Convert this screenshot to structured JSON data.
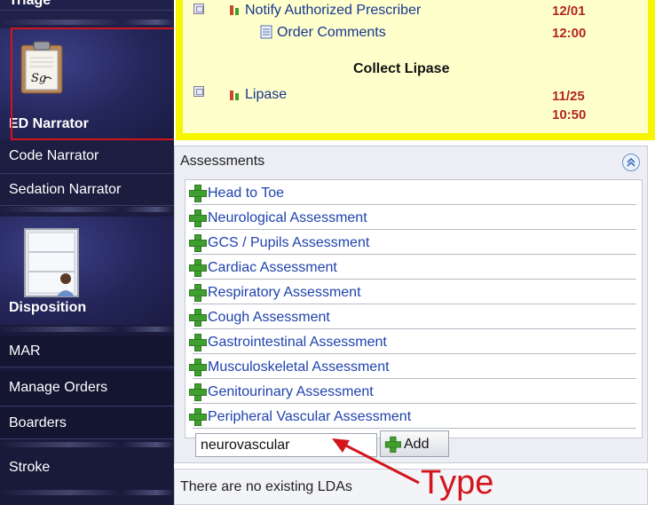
{
  "sidebar": {
    "top_cut_label": "Triage",
    "ed_narrator": "ED Narrator",
    "code_narrator": "Code Narrator",
    "sedation_narrator": "Sedation Narrator",
    "disposition": "Disposition",
    "mar": "MAR",
    "manage_orders": "Manage Orders",
    "boarders": "Boarders",
    "stroke": "Stroke"
  },
  "orders": {
    "row1_label": "Notify Authorized Prescriber",
    "row1_time": "12/01",
    "row2_label": "Order Comments",
    "row2_time": "12:00",
    "section_heading": "Collect Lipase",
    "row3_label": "Lipase",
    "row3_time_date": "11/25",
    "row3_time_clock": "10:50"
  },
  "assessments": {
    "title": "Assessments",
    "items": [
      "Head to Toe",
      "Neurological Assessment",
      "GCS / Pupils Assessment",
      "Cardiac Assessment",
      "Respiratory Assessment",
      "Cough Assessment",
      "Gastrointestinal Assessment",
      "Musculoskeletal Assessment",
      "Genitourinary Assessment",
      "Peripheral Vascular Assessment"
    ],
    "input_value": "neurovascular",
    "add_label": "Add"
  },
  "lda": {
    "message": "There are no existing LDAs"
  },
  "annotation": {
    "text": "Type",
    "color": "#d4141c"
  },
  "icons": [
    "clipboard-signature-icon",
    "window-person-icon",
    "plus-icon",
    "collapse-chevrons-icon",
    "flask-icon",
    "document-icon",
    "order-square-icon"
  ]
}
